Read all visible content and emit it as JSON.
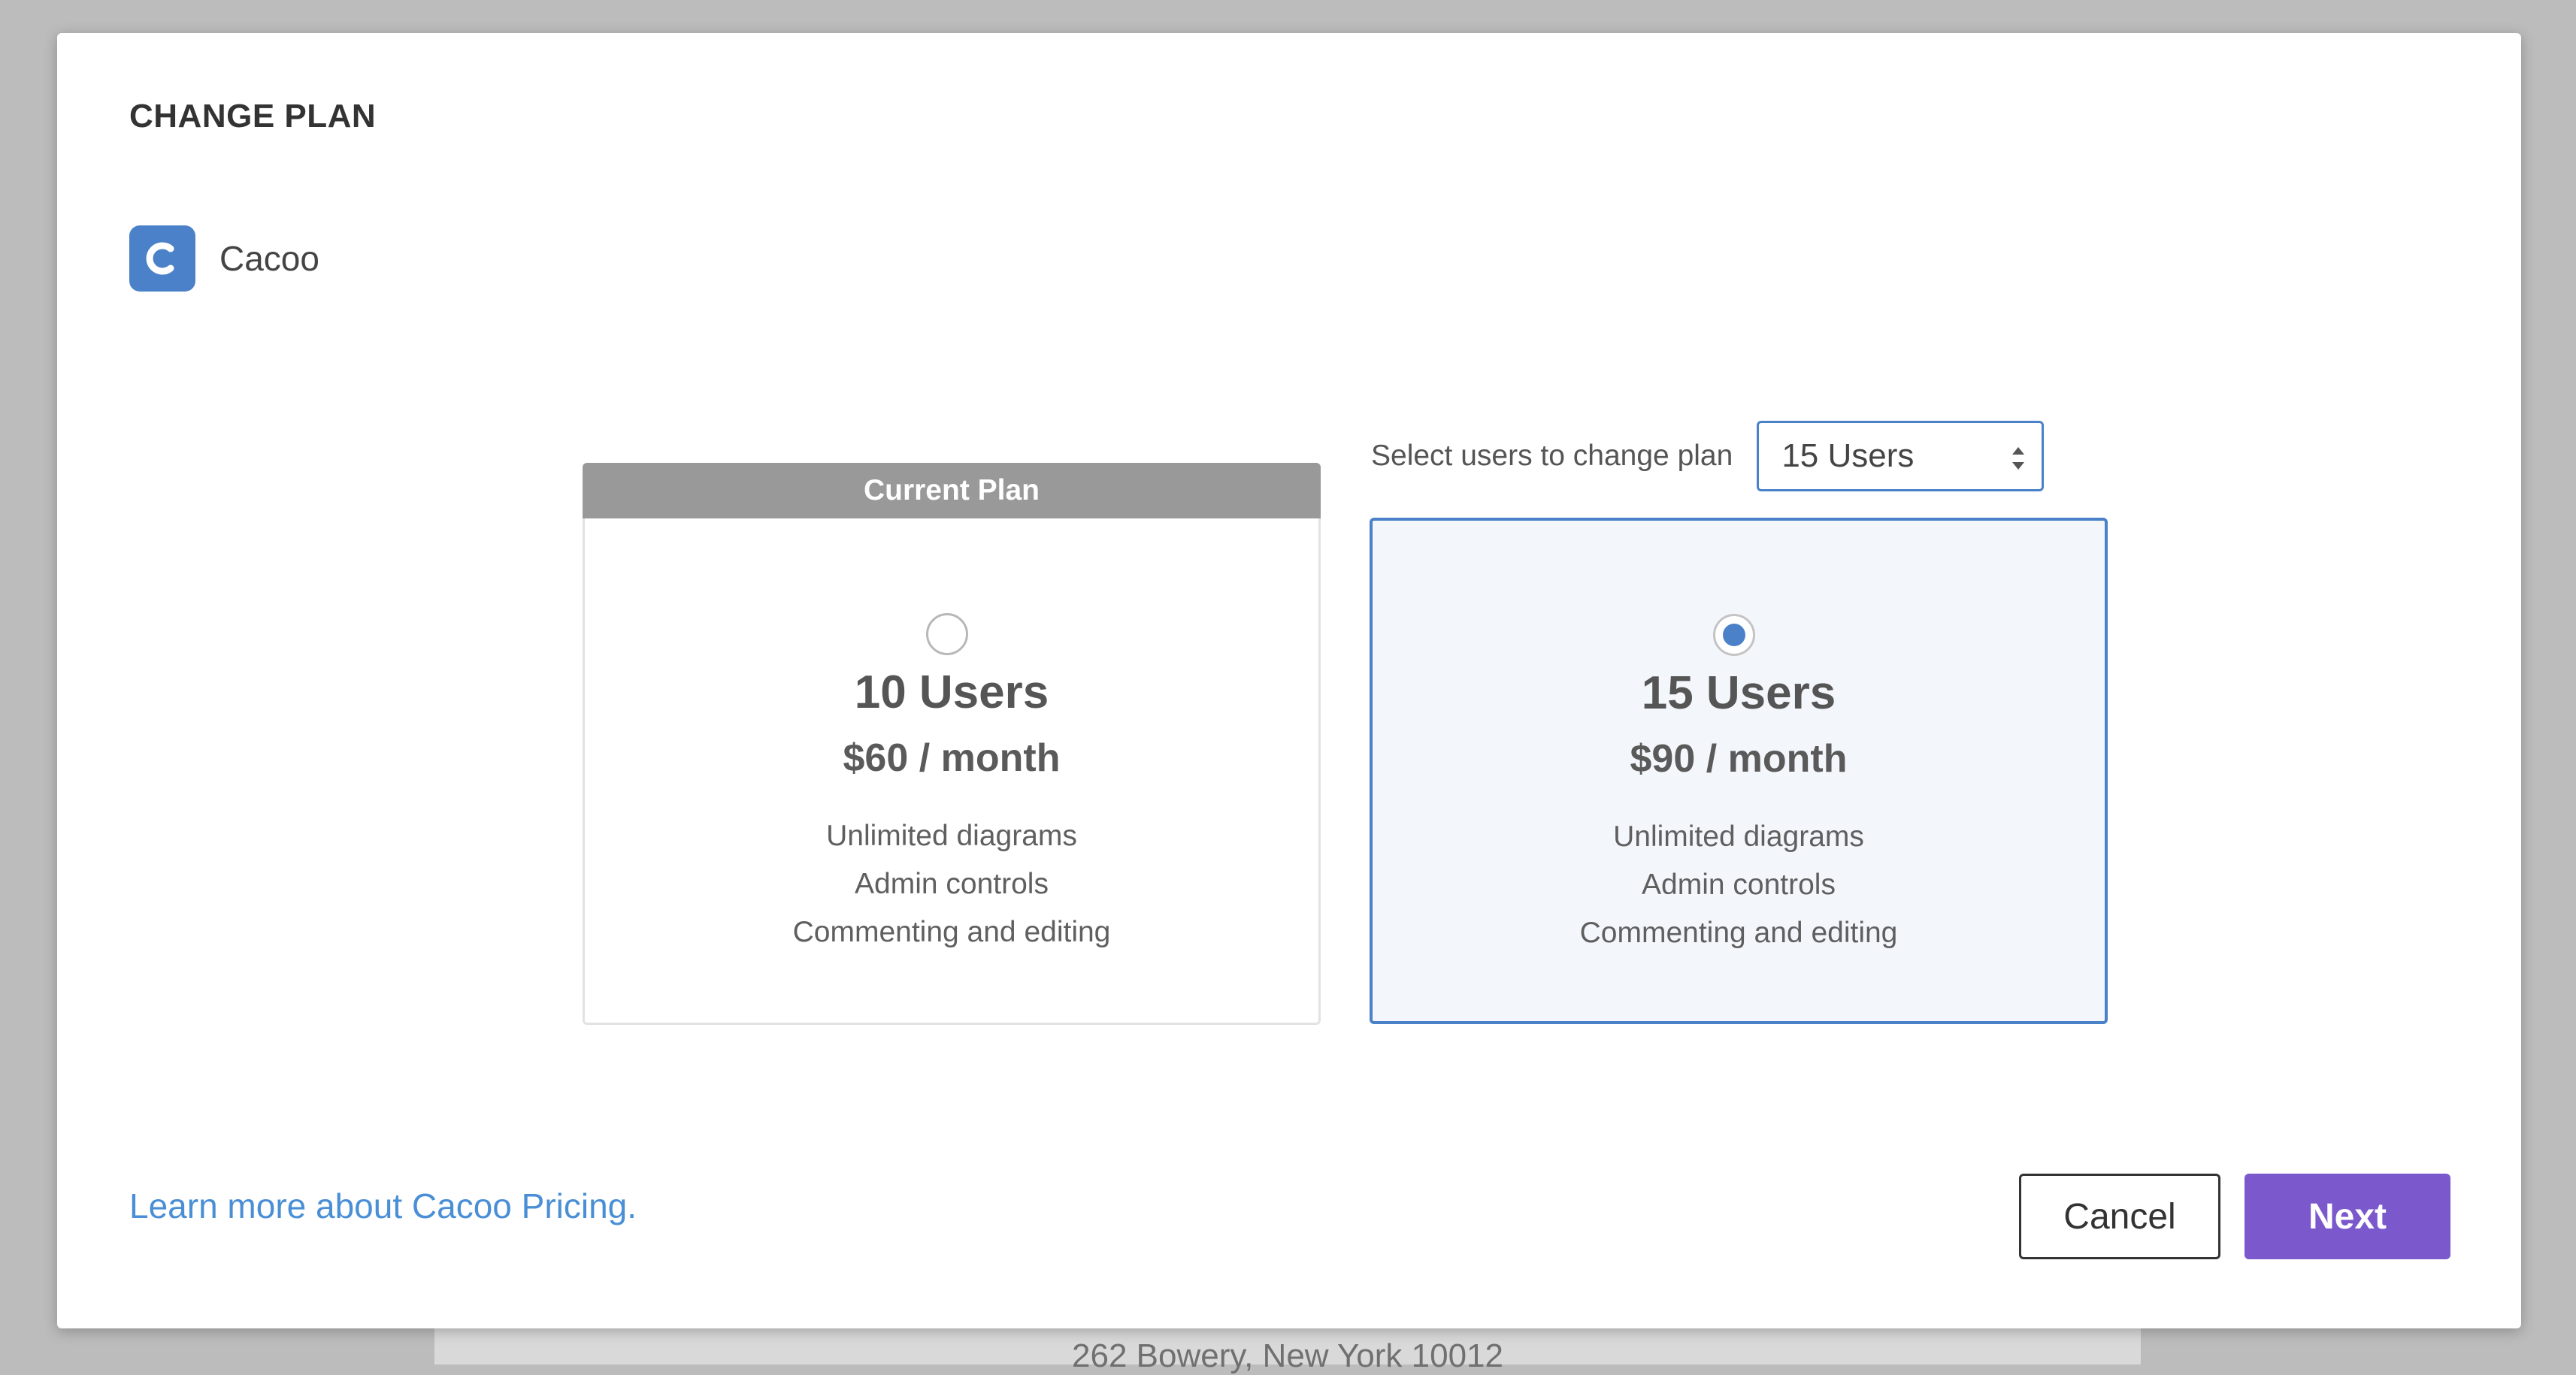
{
  "backdrop": {
    "address": "262 Bowery, New York 10012"
  },
  "modal": {
    "title": "CHANGE PLAN",
    "app": {
      "name": "Cacoo",
      "logo_icon": "cacoo-c-icon",
      "logo_color": "#4a81c9"
    },
    "user_select": {
      "label": "Select users to change plan",
      "selected": "15 Users"
    },
    "plans": [
      {
        "header": "Current Plan",
        "users": "10 Users",
        "price": "$60 / month",
        "features": [
          "Unlimited diagrams",
          "Admin controls",
          "Commenting and editing"
        ],
        "selected": false
      },
      {
        "users": "15 Users",
        "price": "$90 / month",
        "features": [
          "Unlimited diagrams",
          "Admin controls",
          "Commenting and editing"
        ],
        "selected": true
      }
    ],
    "learn_more_link": "Learn more about Cacoo Pricing.",
    "buttons": {
      "cancel": "Cancel",
      "next": "Next"
    }
  },
  "colors": {
    "accent_blue": "#4a81c9",
    "link_blue": "#4a8fd6",
    "next_purple": "#7b58cc",
    "current_header_gray": "#999999"
  }
}
